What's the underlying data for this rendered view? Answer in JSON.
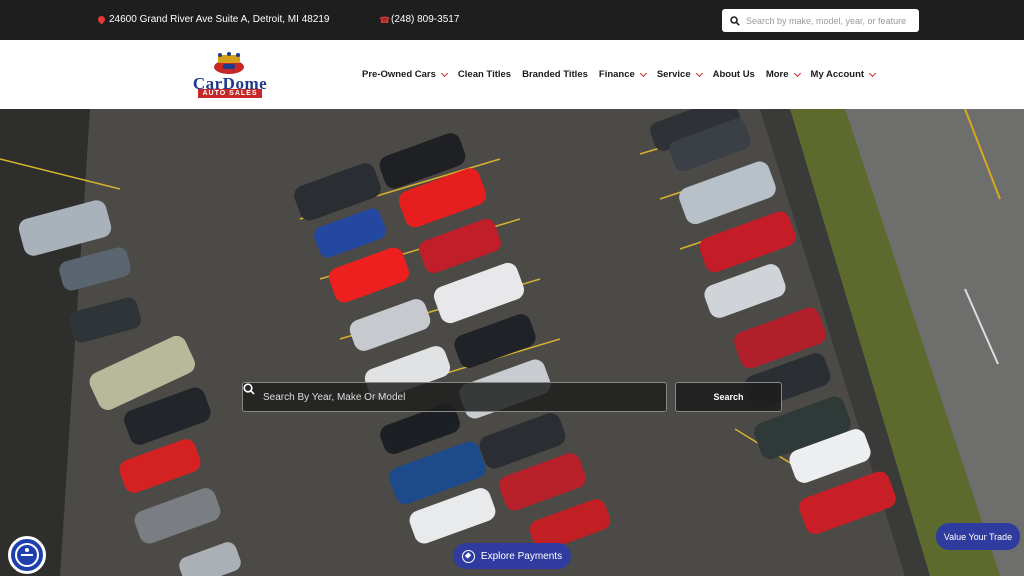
{
  "topbar": {
    "address": "24600 Grand River Ave Suite A, Detroit, MI 48219",
    "phone": "(248) 809-3517",
    "search_placeholder": "Search by make, model, year, or feature"
  },
  "logo": {
    "line1": "CarDome",
    "line2": "AUTO SALES"
  },
  "nav": {
    "items": [
      {
        "label": "Pre-Owned Cars",
        "dropdown": true
      },
      {
        "label": "Clean Titles",
        "dropdown": false
      },
      {
        "label": "Branded Titles",
        "dropdown": false
      },
      {
        "label": "Finance",
        "dropdown": true
      },
      {
        "label": "Service",
        "dropdown": true
      },
      {
        "label": "About Us",
        "dropdown": false
      },
      {
        "label": "More",
        "dropdown": true
      },
      {
        "label": "My Account",
        "dropdown": true
      }
    ]
  },
  "hero": {
    "search_placeholder": "Search By Year, Make Or Model",
    "search_button": "Search"
  },
  "floating": {
    "explore_payments": "Explore Payments",
    "value_trade": "Value Your Trade"
  },
  "colors": {
    "accent": "#c62828",
    "brand_blue": "#2f3b9e",
    "topbar": "#1e1e1e"
  }
}
